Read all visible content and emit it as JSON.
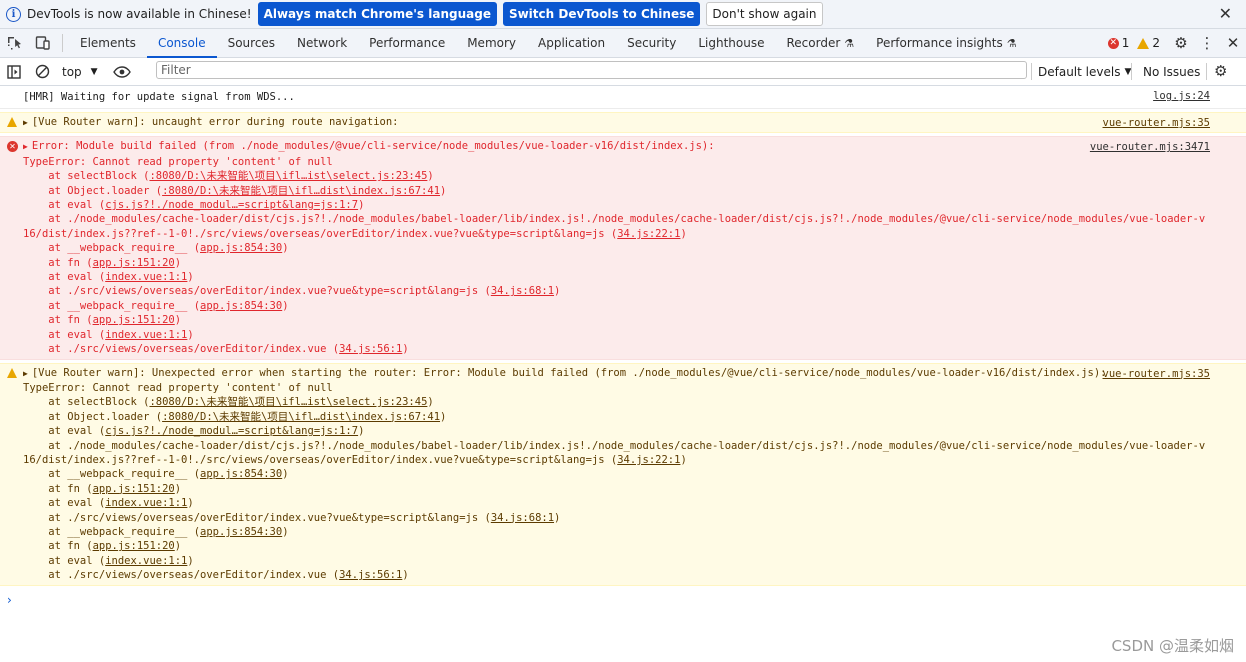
{
  "infobar": {
    "message": "DevTools is now available in Chinese!",
    "btn_match": "Always match Chrome's language",
    "btn_switch": "Switch DevTools to Chinese",
    "btn_dismiss": "Don't show again",
    "icons": {
      "info": "info-icon",
      "close": "close-icon"
    }
  },
  "tabs": [
    "Elements",
    "Console",
    "Sources",
    "Network",
    "Performance",
    "Memory",
    "Application",
    "Security",
    "Lighthouse",
    "Recorder",
    "Performance insights"
  ],
  "active_tab": "Console",
  "counts": {
    "errors": "1",
    "warnings": "2"
  },
  "toolbar": {
    "context": "top",
    "filter_placeholder": "Filter",
    "levels": "Default levels",
    "issues": "No Issues"
  },
  "colors": {
    "accent": "#0b57d0",
    "error": "#dc362e",
    "warning": "#e8a600",
    "error_bg": "#fcebeb",
    "warn_bg": "#fffbe5"
  },
  "messages": [
    {
      "type": "log",
      "text": "[HMR] Waiting for update signal from WDS...",
      "source": "log.js:24"
    },
    {
      "type": "warn",
      "text": "[Vue Router warn]: uncaught error during route navigation:",
      "source": "vue-router.mjs:35"
    },
    {
      "type": "error",
      "head": "Error: Module build failed (from ./node_modules/@vue/cli-service/node_modules/vue-loader-v16/dist/index.js):",
      "source": "vue-router.mjs:3471",
      "body": "TypeError: Cannot read property 'content' of null",
      "frames": [
        {
          "fn": "at selectBlock (",
          "loc": ":8080/D:\\未来智能\\项目\\ifl…ist\\select.js:23:45",
          "end": ")"
        },
        {
          "fn": "at Object.loader (",
          "loc": ":8080/D:\\未来智能\\项目\\ifl…dist\\index.js:67:41",
          "end": ")"
        },
        {
          "fn": "at eval (",
          "loc": "cjs.js?!./node_modul…=script&lang=js:1:7",
          "end": ")"
        },
        {
          "fn": "at ./node_modules/cache-loader/dist/cjs.js?!./node_modules/babel-loader/lib/index.js!./node_modules/cache-loader/dist/cjs.js?!./node_modules/@vue/cli-service/node_modules/vue-loader-v16/dist/index.js??ref--1-0!./src/views/overseas/overEditor/index.vue?vue&type=script&lang=js (",
          "loc": "34.js:22:1",
          "end": ")"
        },
        {
          "fn": "at __webpack_require__ (",
          "loc": "app.js:854:30",
          "end": ")"
        },
        {
          "fn": "at fn (",
          "loc": "app.js:151:20",
          "end": ")"
        },
        {
          "fn": "at eval (",
          "loc": "index.vue:1:1",
          "end": ")"
        },
        {
          "fn": "at ./src/views/overseas/overEditor/index.vue?vue&type=script&lang=js (",
          "loc": "34.js:68:1",
          "end": ")"
        },
        {
          "fn": "at __webpack_require__ (",
          "loc": "app.js:854:30",
          "end": ")"
        },
        {
          "fn": "at fn (",
          "loc": "app.js:151:20",
          "end": ")"
        },
        {
          "fn": "at eval (",
          "loc": "index.vue:1:1",
          "end": ")"
        },
        {
          "fn": "at ./src/views/overseas/overEditor/index.vue (",
          "loc": "34.js:56:1",
          "end": ")"
        }
      ]
    },
    {
      "type": "warn",
      "head": "[Vue Router warn]: Unexpected error when starting the router: Error: Module build failed (from ./node_modules/@vue/cli-service/node_modules/vue-loader-v16/dist/index.js):",
      "source": "vue-router.mjs:35",
      "body": "TypeError: Cannot read property 'content' of null",
      "frames": [
        {
          "fn": "at selectBlock (",
          "loc": ":8080/D:\\未来智能\\项目\\ifl…ist\\select.js:23:45",
          "end": ")"
        },
        {
          "fn": "at Object.loader (",
          "loc": ":8080/D:\\未来智能\\项目\\ifl…dist\\index.js:67:41",
          "end": ")"
        },
        {
          "fn": "at eval (",
          "loc": "cjs.js?!./node_modul…=script&lang=js:1:7",
          "end": ")"
        },
        {
          "fn": "at ./node_modules/cache-loader/dist/cjs.js?!./node_modules/babel-loader/lib/index.js!./node_modules/cache-loader/dist/cjs.js?!./node_modules/@vue/cli-service/node_modules/vue-loader-v16/dist/index.js??ref--1-0!./src/views/overseas/overEditor/index.vue?vue&type=script&lang=js (",
          "loc": "34.js:22:1",
          "end": ")"
        },
        {
          "fn": "at __webpack_require__ (",
          "loc": "app.js:854:30",
          "end": ")"
        },
        {
          "fn": "at fn (",
          "loc": "app.js:151:20",
          "end": ")"
        },
        {
          "fn": "at eval (",
          "loc": "index.vue:1:1",
          "end": ")"
        },
        {
          "fn": "at ./src/views/overseas/overEditor/index.vue?vue&type=script&lang=js (",
          "loc": "34.js:68:1",
          "end": ")"
        },
        {
          "fn": "at __webpack_require__ (",
          "loc": "app.js:854:30",
          "end": ")"
        },
        {
          "fn": "at fn (",
          "loc": "app.js:151:20",
          "end": ")"
        },
        {
          "fn": "at eval (",
          "loc": "index.vue:1:1",
          "end": ")"
        },
        {
          "fn": "at ./src/views/overseas/overEditor/index.vue (",
          "loc": "34.js:56:1",
          "end": ")"
        }
      ]
    }
  ],
  "prompt_glyph": "›",
  "watermark": "CSDN @温柔如烟"
}
